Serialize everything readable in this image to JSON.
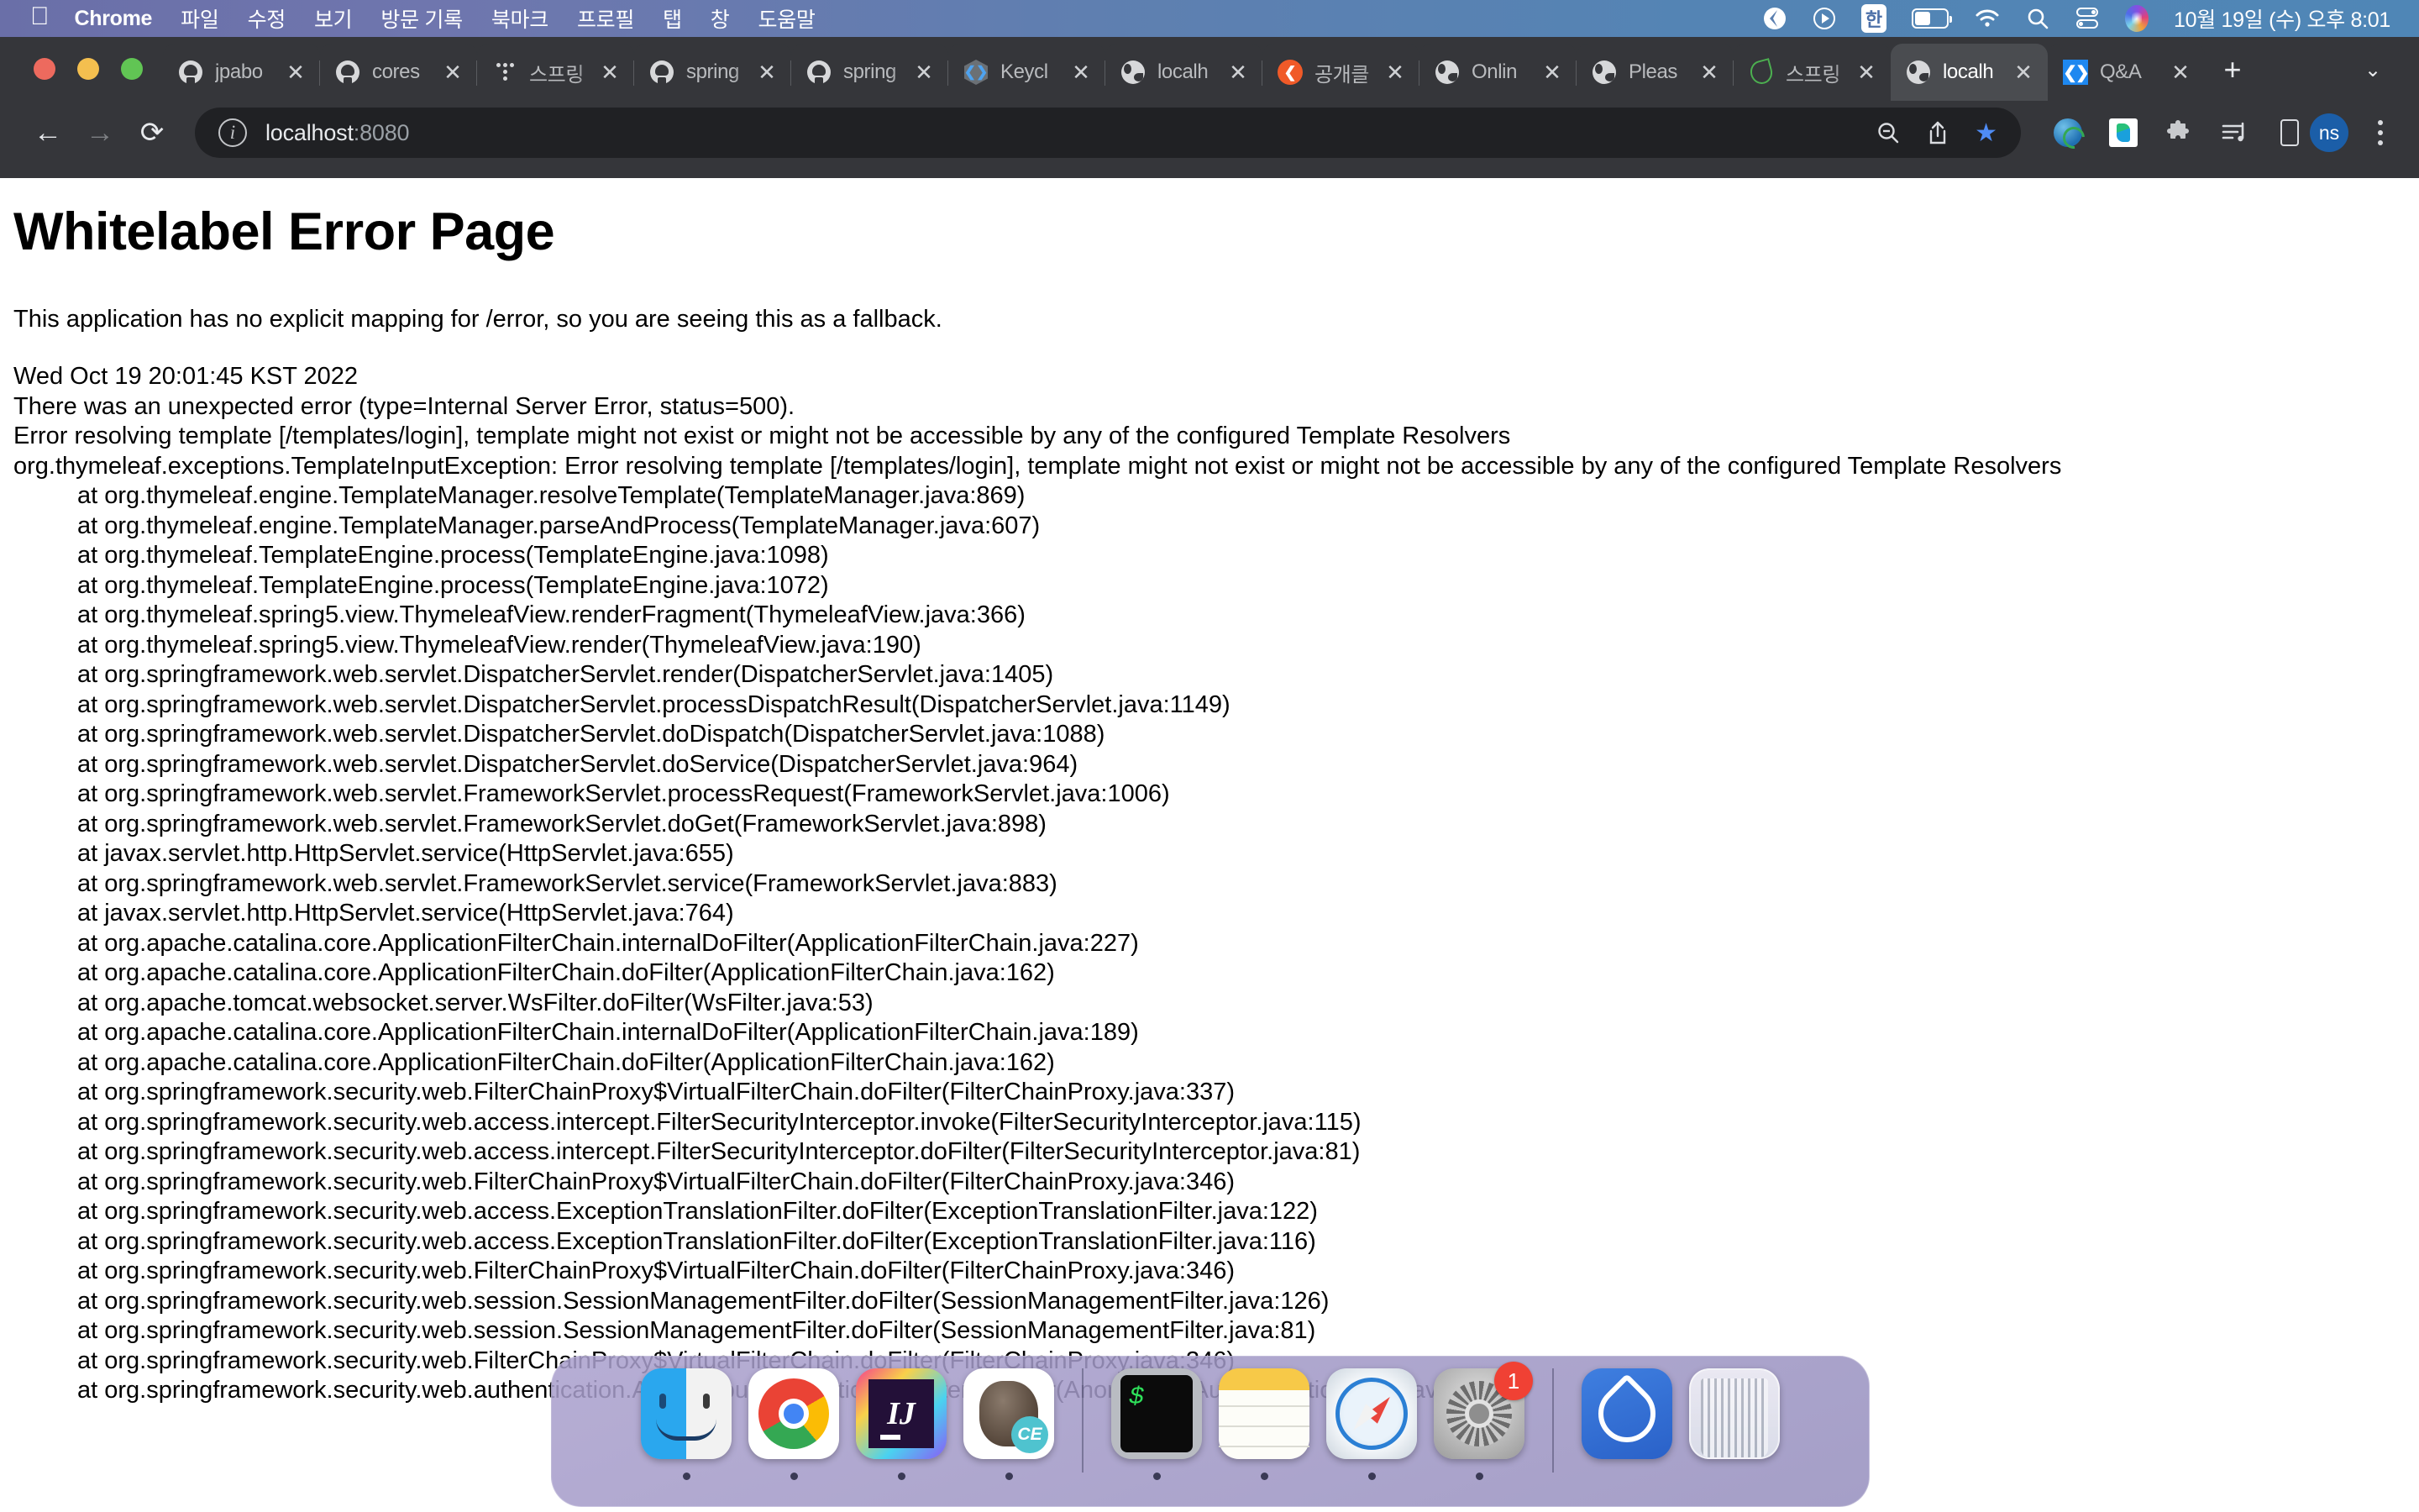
{
  "menubar": {
    "apple_icon": "apple-icon",
    "app_name": "Chrome",
    "items": [
      "파일",
      "수정",
      "보기",
      "방문 기록",
      "북마크",
      "프로필",
      "탭",
      "창",
      "도움말"
    ],
    "status_icons": [
      "control-center-nav-icon",
      "play-circle-icon",
      "korean-input-icon",
      "battery-icon",
      "wifi-icon",
      "search-icon",
      "control-center-icon",
      "siri-icon"
    ],
    "korean_input_label": "한",
    "clock": "10월 19일 (수) 오후 8:01"
  },
  "window": {
    "traffic_lights": [
      "close-button",
      "minimize-button",
      "maximize-button"
    ]
  },
  "tabs": [
    {
      "title": "jpabo",
      "favicon": "github-icon",
      "active": false
    },
    {
      "title": "cores",
      "favicon": "github-icon",
      "active": false
    },
    {
      "title": "스프링",
      "favicon": "dots-icon",
      "active": false
    },
    {
      "title": "spring",
      "favicon": "github-icon",
      "active": false
    },
    {
      "title": "spring",
      "favicon": "github-icon",
      "active": false
    },
    {
      "title": "Keycl",
      "favicon": "keycloak-icon",
      "active": false
    },
    {
      "title": "localh",
      "favicon": "globe-icon",
      "active": false
    },
    {
      "title": "공개클",
      "favicon": "orange-circle-icon",
      "active": false
    },
    {
      "title": "Onlin",
      "favicon": "globe-icon",
      "active": false
    },
    {
      "title": "Pleas",
      "favicon": "globe-icon",
      "active": false
    },
    {
      "title": "스프링",
      "favicon": "leaf-icon",
      "active": false
    },
    {
      "title": "localh",
      "favicon": "globe-icon",
      "active": true
    },
    {
      "title": "Q&A",
      "favicon": "qa-icon",
      "active": false
    }
  ],
  "tabstrip": {
    "close_label": "✕",
    "new_tab_label": "+",
    "tab_list_label": "⌄"
  },
  "toolbar": {
    "back_label": "←",
    "forward_label": "→",
    "reload_label": "⟳",
    "security_label": "ⓘ",
    "url_host": "localhost",
    "url_port": ":8080",
    "url_full": "localhost:8080",
    "zoom_out_label": "⊖",
    "share_label": "⇧",
    "bookmark_label": "★",
    "extensions": [
      "globe-translate-icon",
      "papago-icon",
      "puzzle-extensions-icon",
      "media-list-icon",
      "tablet-device-icon"
    ],
    "profile_initials": "ns",
    "menu_label": "kebab-menu-icon"
  },
  "content": {
    "heading": "Whitelabel Error Page",
    "intro": "This application has no explicit mapping for /error, so you are seeing this as a fallback.",
    "timestamp": "Wed Oct 19 20:01:45 KST 2022",
    "status_line": "There was an unexpected error (type=Internal Server Error, status=500).",
    "message": "Error resolving template [/templates/login], template might not exist or might not be accessible by any of the configured Template Resolvers",
    "exception": "org.thymeleaf.exceptions.TemplateInputException: Error resolving template [/templates/login], template might not exist or might not be accessible by any of the configured Template Resolvers",
    "stack": [
      "at org.thymeleaf.engine.TemplateManager.resolveTemplate(TemplateManager.java:869)",
      "at org.thymeleaf.engine.TemplateManager.parseAndProcess(TemplateManager.java:607)",
      "at org.thymeleaf.TemplateEngine.process(TemplateEngine.java:1098)",
      "at org.thymeleaf.TemplateEngine.process(TemplateEngine.java:1072)",
      "at org.thymeleaf.spring5.view.ThymeleafView.renderFragment(ThymeleafView.java:366)",
      "at org.thymeleaf.spring5.view.ThymeleafView.render(ThymeleafView.java:190)",
      "at org.springframework.web.servlet.DispatcherServlet.render(DispatcherServlet.java:1405)",
      "at org.springframework.web.servlet.DispatcherServlet.processDispatchResult(DispatcherServlet.java:1149)",
      "at org.springframework.web.servlet.DispatcherServlet.doDispatch(DispatcherServlet.java:1088)",
      "at org.springframework.web.servlet.DispatcherServlet.doService(DispatcherServlet.java:964)",
      "at org.springframework.web.servlet.FrameworkServlet.processRequest(FrameworkServlet.java:1006)",
      "at org.springframework.web.servlet.FrameworkServlet.doGet(FrameworkServlet.java:898)",
      "at javax.servlet.http.HttpServlet.service(HttpServlet.java:655)",
      "at org.springframework.web.servlet.FrameworkServlet.service(FrameworkServlet.java:883)",
      "at javax.servlet.http.HttpServlet.service(HttpServlet.java:764)",
      "at org.apache.catalina.core.ApplicationFilterChain.internalDoFilter(ApplicationFilterChain.java:227)",
      "at org.apache.catalina.core.ApplicationFilterChain.doFilter(ApplicationFilterChain.java:162)",
      "at org.apache.tomcat.websocket.server.WsFilter.doFilter(WsFilter.java:53)",
      "at org.apache.catalina.core.ApplicationFilterChain.internalDoFilter(ApplicationFilterChain.java:189)",
      "at org.apache.catalina.core.ApplicationFilterChain.doFilter(ApplicationFilterChain.java:162)",
      "at org.springframework.security.web.FilterChainProxy$VirtualFilterChain.doFilter(FilterChainProxy.java:337)",
      "at org.springframework.security.web.access.intercept.FilterSecurityInterceptor.invoke(FilterSecurityInterceptor.java:115)",
      "at org.springframework.security.web.access.intercept.FilterSecurityInterceptor.doFilter(FilterSecurityInterceptor.java:81)",
      "at org.springframework.security.web.FilterChainProxy$VirtualFilterChain.doFilter(FilterChainProxy.java:346)",
      "at org.springframework.security.web.access.ExceptionTranslationFilter.doFilter(ExceptionTranslationFilter.java:122)",
      "at org.springframework.security.web.access.ExceptionTranslationFilter.doFilter(ExceptionTranslationFilter.java:116)",
      "at org.springframework.security.web.FilterChainProxy$VirtualFilterChain.doFilter(FilterChainProxy.java:346)",
      "at org.springframework.security.web.session.SessionManagementFilter.doFilter(SessionManagementFilter.java:126)",
      "at org.springframework.security.web.session.SessionManagementFilter.doFilter(SessionManagementFilter.java:81)",
      "at org.springframework.security.web.FilterChainProxy$VirtualFilterChain.doFilter(FilterChainProxy.java:346)",
      "at org.springframework.security.web.authentication.AnonymousAuthenticationFilter.doFilter(AnonymousAuthenticationFilter.java:109)"
    ]
  },
  "dock": {
    "items": [
      {
        "name": "finder",
        "running": true
      },
      {
        "name": "chrome",
        "running": true
      },
      {
        "name": "intellij-idea",
        "running": true
      },
      {
        "name": "gitkraken",
        "running": true
      },
      {
        "name": "terminal",
        "running": true
      },
      {
        "name": "notes",
        "running": true
      },
      {
        "name": "safari",
        "running": true
      },
      {
        "name": "system-settings",
        "running": true,
        "badge": "1"
      },
      {
        "name": "unknown-blue-app",
        "running": false
      },
      {
        "name": "trash",
        "running": false
      }
    ],
    "settings_badge": "1",
    "terminal_prompt": "$"
  },
  "colors": {
    "chrome_toolbar": "#35363a",
    "chrome_tabstrip": "#202124",
    "active_tab": "#4a4c50",
    "omnibox": "#202124",
    "bookmark_star": "#4f8cf5",
    "avatar": "#1b5ea8",
    "badge_red": "#f04134",
    "page_background": "#ffffff",
    "menubar_gradient_left": "#6a6fa8",
    "menubar_gradient_right": "#4f86b6"
  }
}
